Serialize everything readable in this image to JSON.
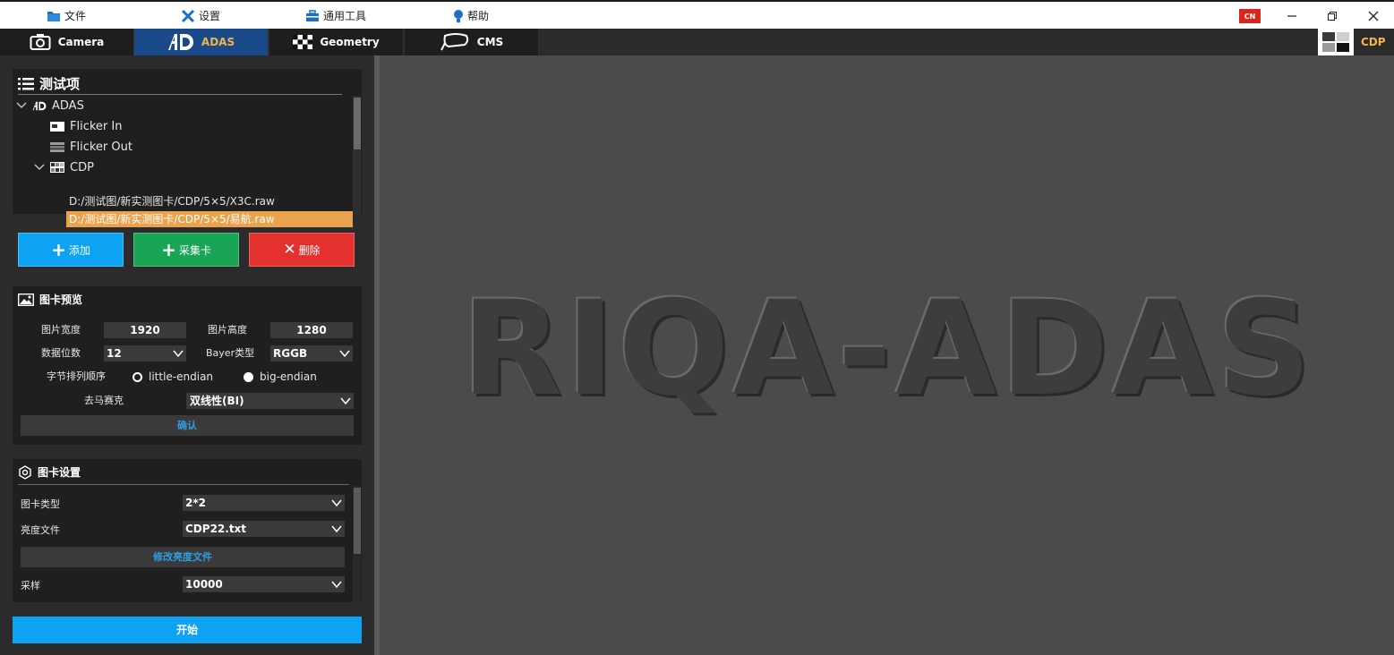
{
  "menu": {
    "items": [
      {
        "label": "文件",
        "icon": "folder-icon"
      },
      {
        "label": "设置",
        "icon": "wrench-icon"
      },
      {
        "label": "通用工具",
        "icon": "toolbox-icon"
      },
      {
        "label": "帮助",
        "icon": "lightbulb-icon"
      }
    ],
    "language": "CN"
  },
  "tabs": [
    {
      "label": "Camera",
      "icon": "camera-icon",
      "active": false
    },
    {
      "label": "ADAS",
      "icon": "adas-logo-icon",
      "active": true
    },
    {
      "label": "Geometry",
      "icon": "checker-icon",
      "active": false
    },
    {
      "label": "CMS",
      "icon": "mirror-icon",
      "active": false
    }
  ],
  "mode_badge": {
    "label": "CDP",
    "icon": "cdp-chart-icon"
  },
  "test_items": {
    "title": "测试项",
    "tree": {
      "root": "ADAS",
      "children": [
        "Flicker In",
        "Flicker Out"
      ],
      "group": "CDP",
      "files": [
        "D:/测试图/新实测图卡/CDP/5×5/X3C.raw",
        "D:/测试图/新实测图卡/CDP/5×5/易航.raw"
      ],
      "selected_file_index": 1
    }
  },
  "actions": {
    "add": "添加",
    "capture_card": "采集卡",
    "delete": "删除",
    "colors": {
      "add": "#0ea2f2",
      "capture": "#1aa556",
      "delete": "#e53030"
    }
  },
  "preview": {
    "title": "图卡预览",
    "width_label": "图片宽度",
    "width_value": "1920",
    "height_label": "图片高度",
    "height_value": "1280",
    "bits_label": "数据位数",
    "bits_value": "12",
    "bayer_label": "Bayer类型",
    "bayer_value": "RGGB",
    "endian_label": "字节排列顺序",
    "endian_little": "little-endian",
    "endian_big": "big-endian",
    "endian_selected": "big-endian",
    "demosaic_label": "去马赛克",
    "demosaic_value": "双线性(BI)",
    "confirm": "确认"
  },
  "chart_settings": {
    "title": "图卡设置",
    "type_label": "图卡类型",
    "type_value": "2*2",
    "brightness_label": "亮度文件",
    "brightness_value": "CDP22.txt",
    "edit_brightness": "修改亮度文件",
    "sample_label": "采样",
    "sample_value": "10000"
  },
  "start": "开始",
  "preview_logo": "RIQA-ADAS"
}
